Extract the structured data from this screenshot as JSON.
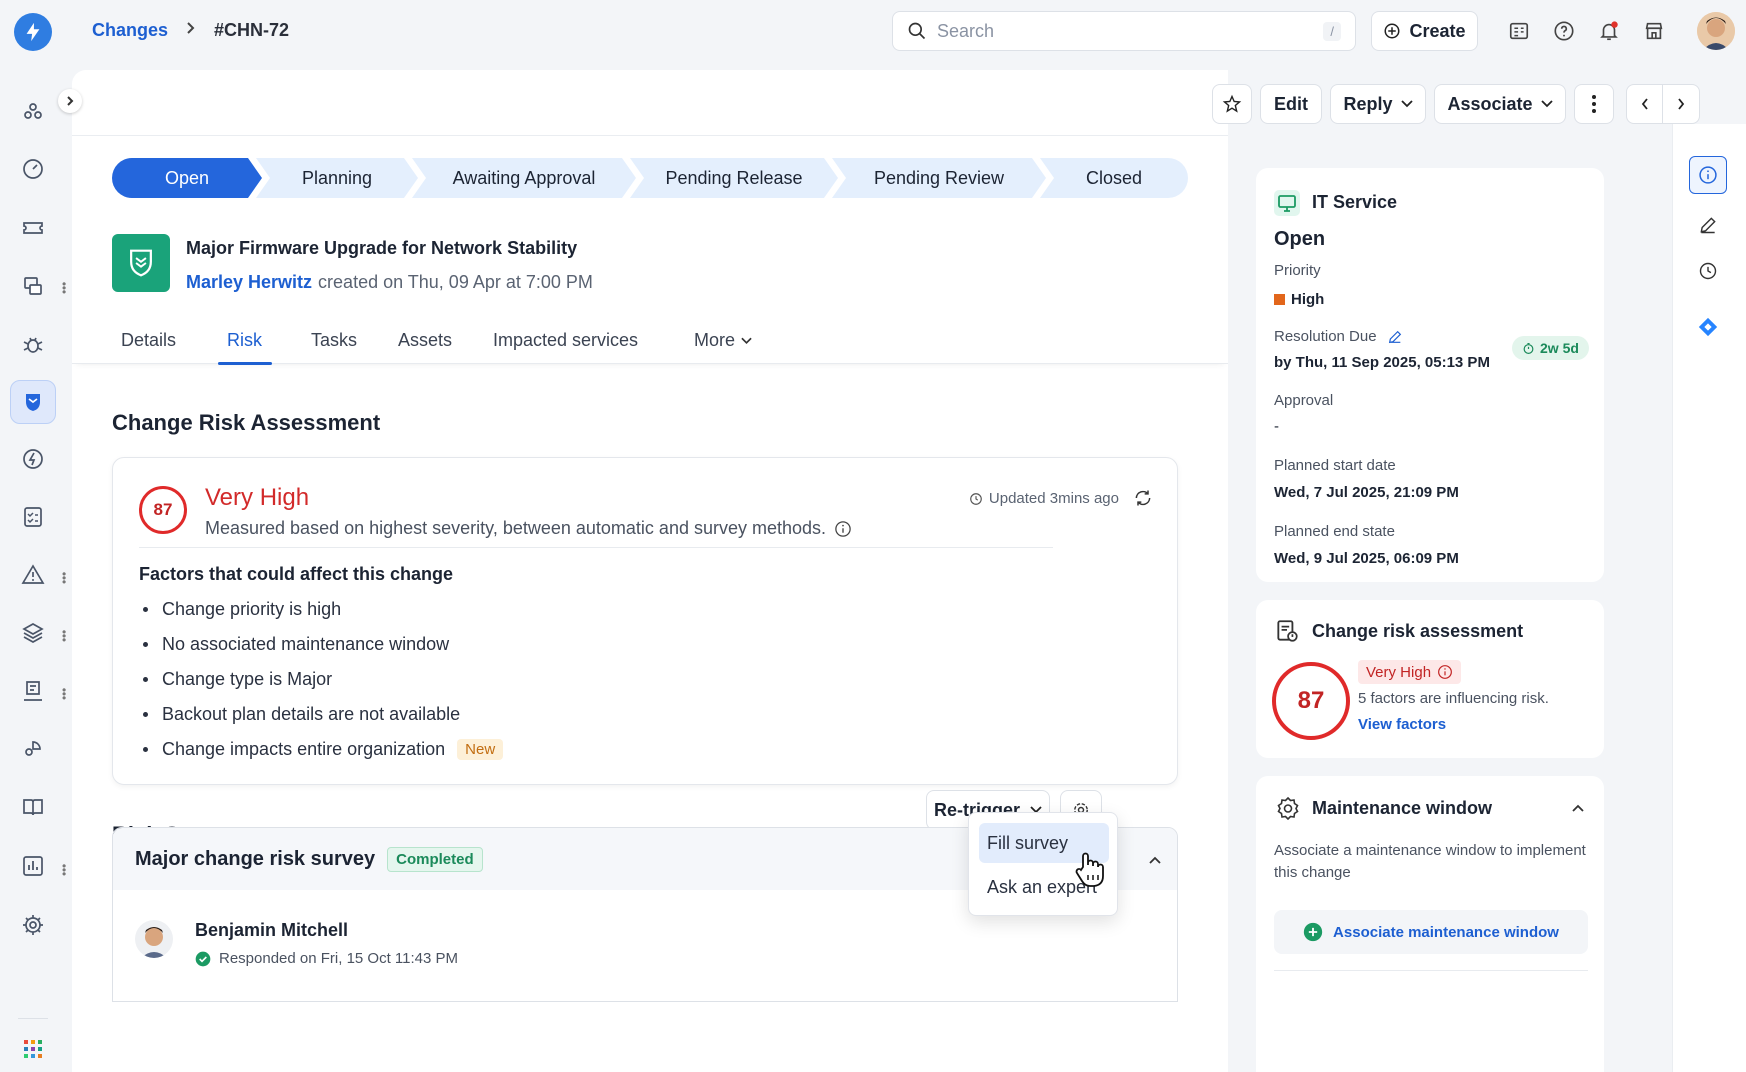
{
  "app": {
    "brand_color": "#2f7de1"
  },
  "breadcrumb": {
    "parent": "Changes",
    "separator": ">",
    "current": "#CHN-72"
  },
  "search": {
    "placeholder": "Search",
    "shortcut": "/"
  },
  "header": {
    "create_label": "Create",
    "icons": [
      "tasks-icon",
      "help-icon",
      "notifications-icon",
      "marketplace-icon"
    ]
  },
  "toolbar": {
    "edit": "Edit",
    "reply": "Reply",
    "associate": "Associate"
  },
  "stages": [
    {
      "label": "Open",
      "active": true
    },
    {
      "label": "Planning"
    },
    {
      "label": "Awaiting Approval"
    },
    {
      "label": "Pending Release"
    },
    {
      "label": "Pending Review"
    },
    {
      "label": "Closed"
    }
  ],
  "record": {
    "title": "Major Firmware Upgrade for Network Stability",
    "author": "Marley Herwitz",
    "created": "created on Thu, 09 Apr at 7:00 PM"
  },
  "tabs": [
    "Details",
    "Risk",
    "Tasks",
    "Assets",
    "Impacted services",
    "More"
  ],
  "active_tab": "Risk",
  "risk": {
    "section_title": "Change Risk Assessment",
    "score": "87",
    "level": "Very High",
    "description": "Measured based on highest severity, between automatic and survey methods.",
    "updated": "Updated 3mins ago",
    "factors_title": "Factors that could affect this change",
    "factors": [
      "Change priority is high",
      "No associated maintenance window",
      "Change type is Major",
      "Backout plan details are not available",
      "Change impacts entire organization"
    ],
    "new_badge": "New"
  },
  "survey": {
    "section_title": "Risk Survey",
    "retrigger": "Re-trigger",
    "name": "Major change risk survey",
    "status": "Completed",
    "responder": "Benjamin Mitchell",
    "responded": "Responded on Fri, 15 Oct 11:43 PM",
    "menu": [
      "Fill survey",
      "Ask an expert"
    ]
  },
  "sidebar_info": {
    "service": "IT Service",
    "status": "Open",
    "priority_label": "Priority",
    "priority": "High",
    "priority_color": "#e2661b",
    "resolution_label": "Resolution Due",
    "resolution": "by Thu, 11 Sep 2025, 05:13 PM",
    "sla": "2w 5d",
    "approval_label": "Approval",
    "approval": "-",
    "start_label": "Planned start date",
    "start": "Wed, 7 Jul 2025, 21:09 PM",
    "end_label": "Planned end state",
    "end": "Wed, 9 Jul 2025, 06:09 PM"
  },
  "sidebar_risk": {
    "title": "Change risk assessment",
    "score": "87",
    "level": "Very High",
    "summary": "5 factors are influencing risk.",
    "link": "View factors"
  },
  "maintenance": {
    "title": "Maintenance window",
    "description": "Associate a maintenance window to implement this change",
    "action": "Associate maintenance window"
  }
}
